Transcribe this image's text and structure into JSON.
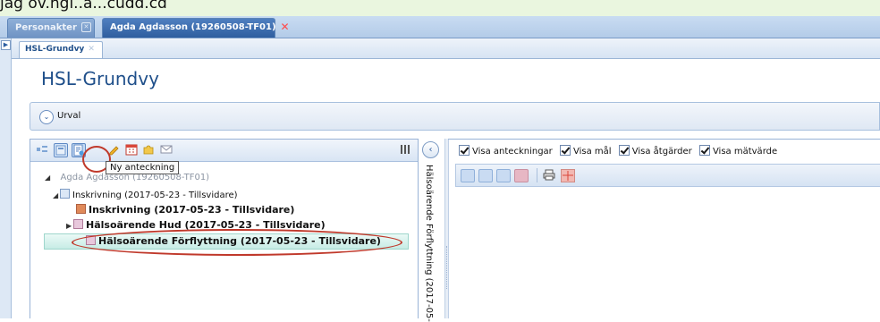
{
  "caption": "jag öv.ngi..a...cudd.cd",
  "tabs": [
    {
      "label": "Personakter"
    },
    {
      "label": "Agda Agdasson (19260508-TF01)"
    }
  ],
  "subtab": {
    "label": "HSL-Grundvy"
  },
  "page": {
    "title": "HSL-Grundvy"
  },
  "urval": {
    "label": "Urval"
  },
  "tooltip": "Ny anteckning",
  "vertical_text": "Hälsoärende Förflyttning (2017-05-",
  "checkboxes": [
    {
      "label": "Visa anteckningar",
      "checked": true
    },
    {
      "label": "Visa mål",
      "checked": true
    },
    {
      "label": "Visa åtgärder",
      "checked": true
    },
    {
      "label": "Visa mätvärde",
      "checked": true
    }
  ],
  "tree": {
    "root": "Agda Agdasson (19260508-TF01)",
    "inskrivning_group": "Inskrivning (2017-05-23 - Tillsvidare)",
    "inskrivning": "Inskrivning (2017-05-23 - Tillsvidare)",
    "halsoarende_hud": "Hälsoärende Hud (2017-05-23 - Tillsvidare)",
    "halsoarende_forflyttning": "Hälsoärende Förflyttning (2017-05-23 - Tillsvidare)"
  },
  "colors": {
    "highlight_ring": "#c0392b",
    "accent": "#1f4f8a"
  }
}
